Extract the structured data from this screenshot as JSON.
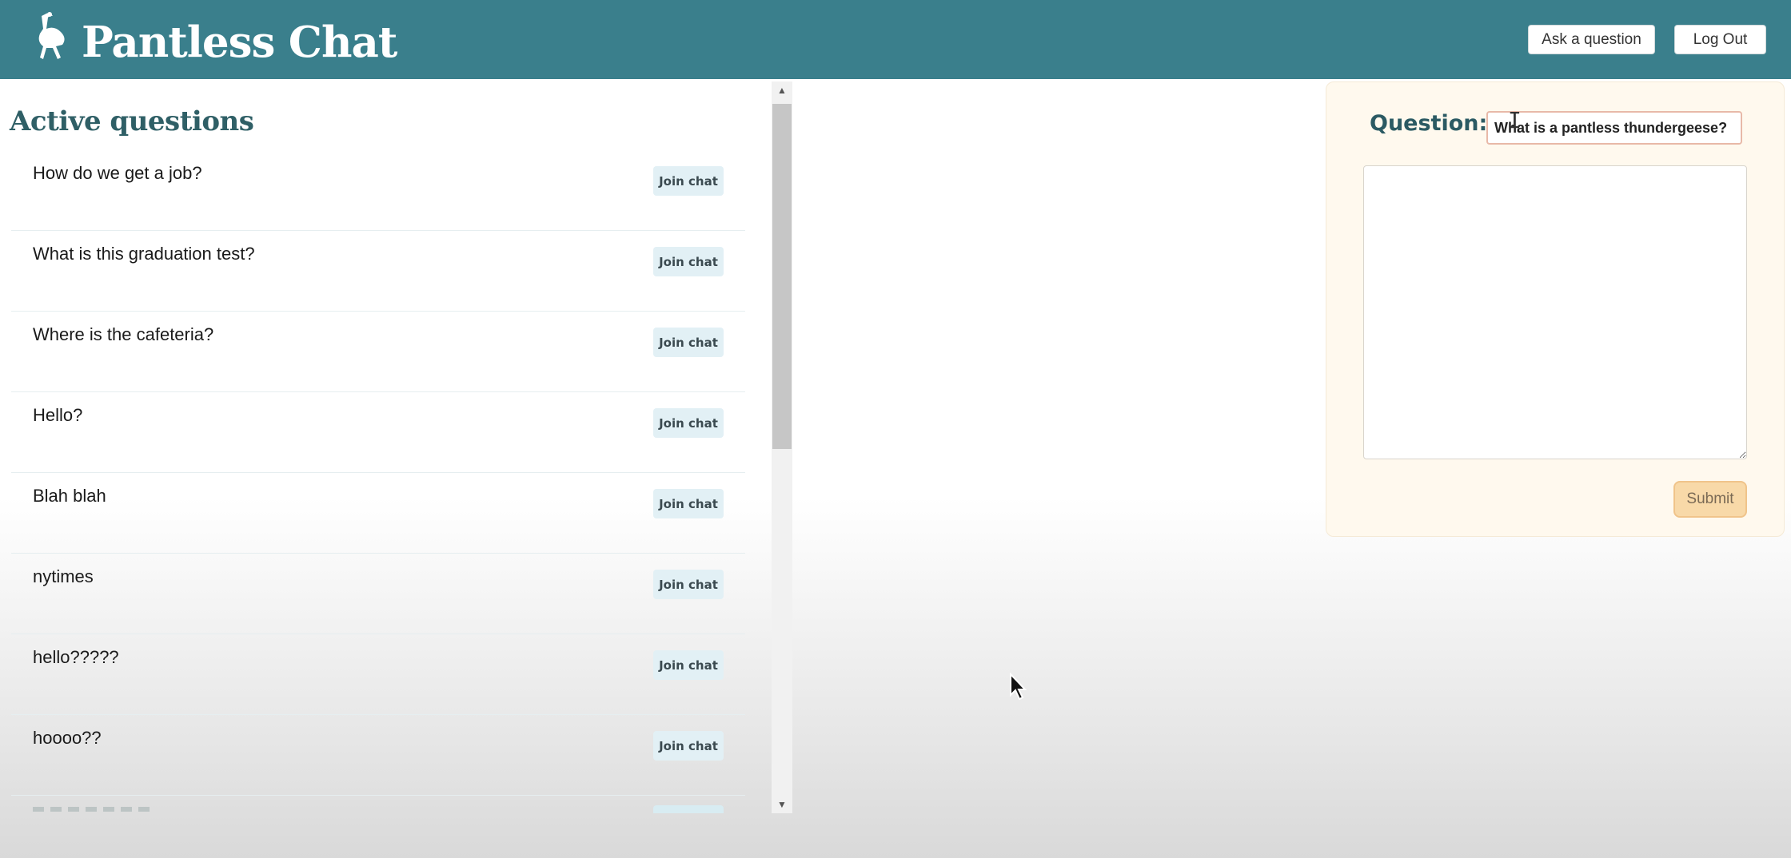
{
  "header": {
    "brand": "Pantless Chat",
    "ask_button": "Ask a question",
    "logout_button": "Log Out"
  },
  "questions_panel": {
    "title": "Active questions",
    "join_label": "Join chat",
    "items": [
      {
        "text": "How do we get a job?"
      },
      {
        "text": "What is this graduation test?"
      },
      {
        "text": "Where is the cafeteria?"
      },
      {
        "text": "Hello?"
      },
      {
        "text": "Blah blah"
      },
      {
        "text": "nytimes"
      },
      {
        "text": "hello?????"
      },
      {
        "text": "hoooo??"
      }
    ]
  },
  "question_form": {
    "label": "Question:",
    "question_value": "What is a pantless thundergeese?",
    "details_value": "",
    "submit_label": "Submit"
  },
  "colors": {
    "header_bg": "#3a7f8c",
    "title_color": "#2f5f66",
    "join_bg": "#e2f0f5",
    "form_bg": "#fff9ee",
    "submit_bg": "#f8d9a8"
  },
  "icons": [
    "ostrich-logo-icon",
    "scroll-up-icon",
    "scroll-down-icon",
    "resize-handle-icon",
    "mouse-pointer-icon",
    "text-cursor-icon"
  ]
}
